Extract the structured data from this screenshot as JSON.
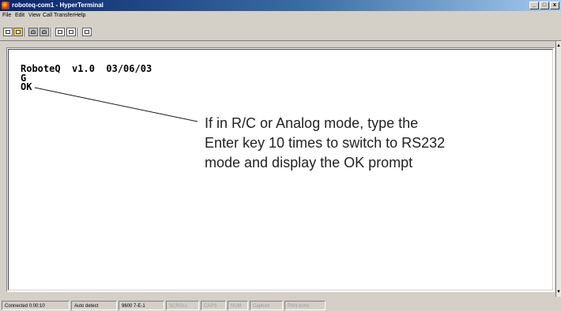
{
  "window": {
    "title": "roboteq-com1 - HyperTerminal",
    "controls": [
      "_",
      "□",
      "x"
    ]
  },
  "menu": [
    "File",
    "Edit",
    "View",
    "Call",
    "Transfer",
    "Help"
  ],
  "toolbar": {
    "buttons": [
      {
        "icon": "new-connection-icon"
      },
      {
        "icon": "open-folder-icon"
      },
      {
        "icon": "dial-phone-icon"
      },
      {
        "icon": "disconnect-icon"
      },
      {
        "icon": "send-file-icon"
      },
      {
        "icon": "receive-file-icon"
      },
      {
        "icon": "properties-icon"
      }
    ]
  },
  "terminal": {
    "lines": [
      "RoboteQ  v1.0  03/06/03",
      "G",
      "OK"
    ]
  },
  "annotation": {
    "lines": [
      "If in R/C or Analog mode, type the",
      "Enter key 10 times to switch to RS232",
      "mode and display the OK prompt"
    ]
  },
  "status": {
    "connected": "Connected 0:00:10",
    "detect": "Auto detect",
    "settings": "9600 7-E-1",
    "scroll": "SCROLL",
    "caps": "CAPS",
    "num": "NUM",
    "capture": "Capture",
    "print_echo": "Print echo"
  }
}
